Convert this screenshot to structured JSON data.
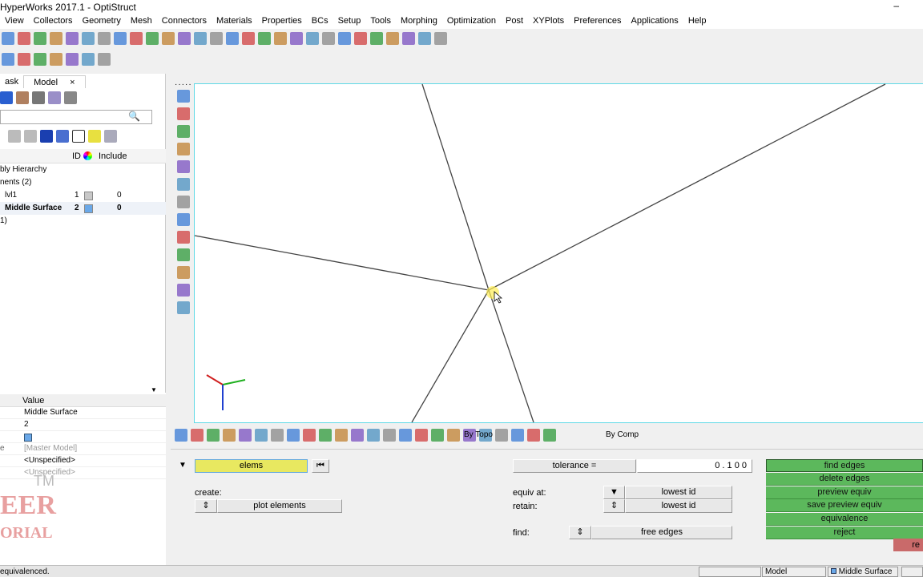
{
  "title": "HyperWorks 2017.1 - OptiStruct",
  "window_min": "–",
  "menu": [
    "View",
    "Collectors",
    "Geometry",
    "Mesh",
    "Connectors",
    "Materials",
    "Properties",
    "BCs",
    "Setup",
    "Tools",
    "Morphing",
    "Optimization",
    "Post",
    "XYPlots",
    "Preferences",
    "Applications",
    "Help"
  ],
  "toolbar_row1": [
    "save-icon",
    "import-icon",
    "export-icon",
    "user-icon",
    "folder-icon",
    "add-icon",
    "page-icon",
    "frame-icon",
    "image-icon",
    "zoom-icon",
    "arrow-left-icon",
    "axis-icon",
    "axis-icon",
    "axis-icon",
    "axis-icon",
    "axis-icon",
    "axis-icon",
    "iso-icon",
    "view-icon",
    "zoom-fit-icon",
    "zoom-out-icon",
    "pan-icon",
    "hand-icon",
    "move-icon",
    "up-down-icon",
    "rotate-icon",
    "cut-icon",
    "copy-icon"
  ],
  "toolbar_row2": [
    "mask-icon",
    "mask-icon",
    "unmask-icon",
    "show-icon",
    "hide-icon",
    "undo-icon",
    "redo-icon"
  ],
  "tabs": {
    "task": "ask",
    "model": "Model",
    "close": "×"
  },
  "tree": {
    "col_id": "ID",
    "col_include": "Include",
    "rows": [
      {
        "label": "bly Hierarchy"
      },
      {
        "label": "nents (2)"
      },
      {
        "label": "lvl1",
        "id": "1",
        "include": "0",
        "color": "#c8c8c8"
      },
      {
        "label": "Middle Surface",
        "id": "2",
        "include": "0",
        "color": "#6aa8e8",
        "bold": true
      },
      {
        "label": "1)"
      }
    ]
  },
  "props": {
    "col_value": "Value",
    "values": [
      "Middle Surface",
      "2",
      "",
      "[Master Model]",
      "<Unspecified>",
      "<Unspecified>"
    ],
    "row_label_4": "e"
  },
  "watermark": {
    "tm": "TM",
    "line1": "EER",
    "line2": "ORIAL"
  },
  "bottom_toolbar": {
    "by_topo": "By Topo",
    "by_comp": "By Comp"
  },
  "panel": {
    "entity": "elems",
    "create_label": "create:",
    "create_value": "plot elements",
    "tolerance_label": "tolerance =",
    "tolerance_value": "0 . 1 0 0",
    "equiv_at_label": "equiv at:",
    "equiv_at_value": "lowest id",
    "retain_label": "retain:",
    "retain_value": "lowest id",
    "find_label": "find:",
    "find_value": "free edges",
    "actions": [
      "find edges",
      "delete edges",
      "preview equiv",
      "save preview equiv",
      "equivalence",
      "reject"
    ],
    "return": "re"
  },
  "status": {
    "message": "equivalenced.",
    "model": "Model",
    "component": "Middle Surface"
  },
  "colors": {
    "accent_green": "#5cb85c",
    "return_red": "#c96a6a",
    "viewport_border": "#5fd9e6"
  }
}
